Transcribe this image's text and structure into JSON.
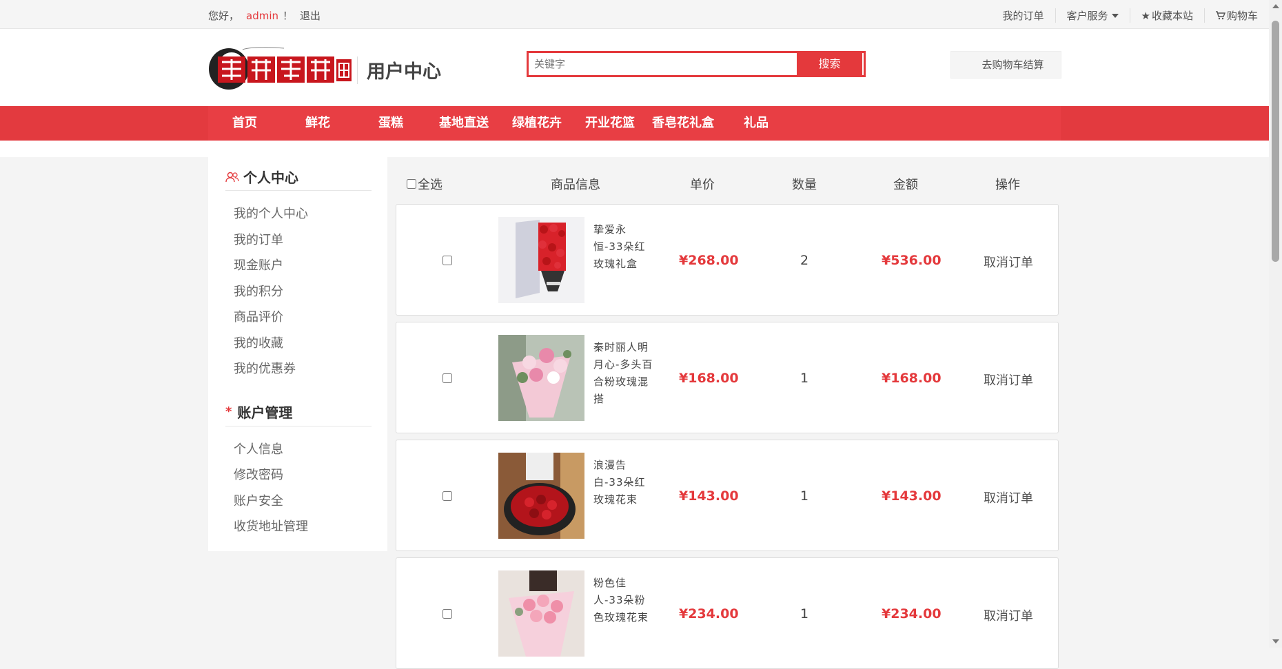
{
  "topbar": {
    "greeting": "您好，",
    "username": "admin",
    "exclaim": "！",
    "logout": "退出",
    "links": {
      "orders": "我的订单",
      "service": "客户服务",
      "favorite": "收藏本站",
      "cart": "购物车"
    }
  },
  "header": {
    "title": "用户中心",
    "search_placeholder": "关键字",
    "search_button": "搜索",
    "checkout": "去购物车结算"
  },
  "nav": [
    "首页",
    "鲜花",
    "蛋糕",
    "基地直送",
    "绿植花卉",
    "开业花篮",
    "香皂花礼盒",
    "礼品"
  ],
  "sidebar": {
    "personal": {
      "title": "个人中心",
      "items": [
        "我的个人中心",
        "我的订单",
        "现金账户",
        "我的积分",
        "商品评价",
        "我的收藏",
        "我的优惠券"
      ]
    },
    "account": {
      "title": "账户管理",
      "items": [
        "个人信息",
        "修改密码",
        "账户安全",
        "收货地址管理"
      ]
    }
  },
  "table_header": {
    "select_all": "全选",
    "product": "商品信息",
    "price": "单价",
    "quantity": "数量",
    "amount": "金额",
    "action": "操作"
  },
  "orders": [
    {
      "name": "挚爱永恒-33朵红玫瑰礼盒",
      "price": "¥268.00",
      "qty": "2",
      "amount": "¥536.00",
      "action": "取消订单"
    },
    {
      "name": "秦时丽人明月心-多头百合粉玫瑰混搭",
      "price": "¥168.00",
      "qty": "1",
      "amount": "¥168.00",
      "action": "取消订单"
    },
    {
      "name": "浪漫告白-33朵红玫瑰花束",
      "price": "¥143.00",
      "qty": "1",
      "amount": "¥143.00",
      "action": "取消订单"
    },
    {
      "name": "粉色佳人-33朵粉色玫瑰花束",
      "price": "¥234.00",
      "qty": "1",
      "amount": "¥234.00",
      "action": "取消订单"
    }
  ],
  "colors": {
    "accent": "#e4393c",
    "nav": "#e83e44"
  }
}
